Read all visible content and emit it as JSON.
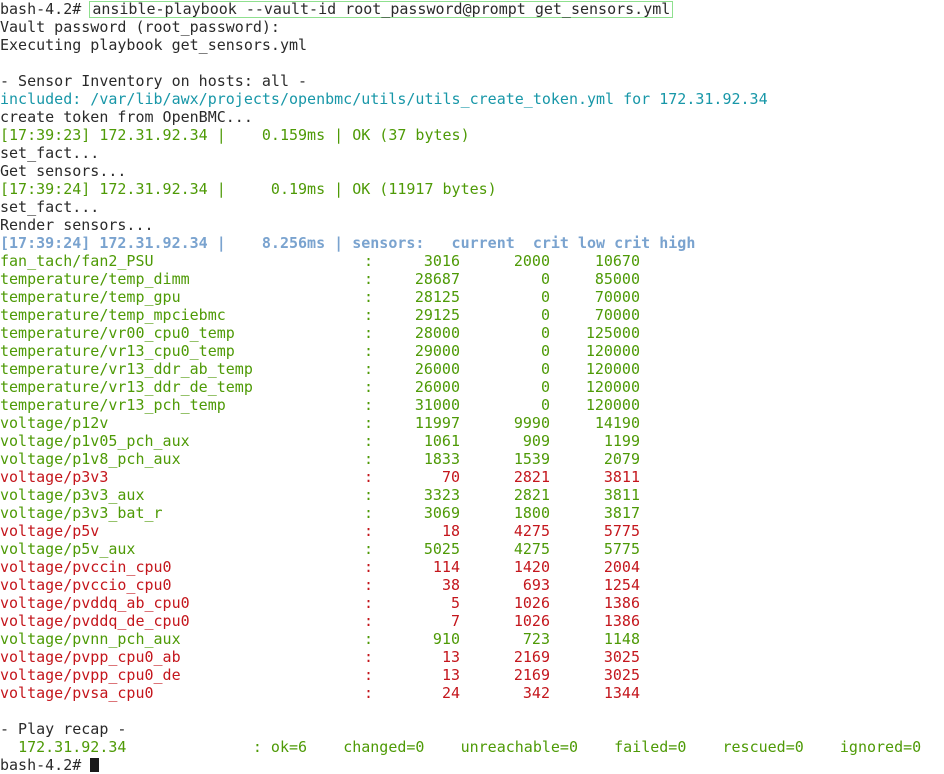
{
  "prompt": "bash-4.2#",
  "command": "ansible-playbook --vault-id root_password@prompt get_sensors.yml",
  "pre_lines": [
    {
      "text": "Vault password (root_password):",
      "style": "plain"
    },
    {
      "text": "Executing playbook get_sensors.yml",
      "style": "plain"
    },
    {
      "text": "",
      "style": "plain"
    },
    {
      "text": "- Sensor Inventory on hosts: all -",
      "style": "plain"
    },
    {
      "text": "included: /var/lib/awx/projects/openbmc/utils/utils_create_token.yml for 172.31.92.34",
      "style": "included"
    },
    {
      "text": "create token from OpenBMC...",
      "style": "plain"
    },
    {
      "text": "[17:39:23] 172.31.92.34 |    0.159ms | OK (37 bytes)",
      "style": "green"
    },
    {
      "text": "set_fact...",
      "style": "plain"
    },
    {
      "text": "Get sensors...",
      "style": "plain"
    },
    {
      "text": "[17:39:24] 172.31.92.34 |     0.19ms | OK (11917 bytes)",
      "style": "green"
    },
    {
      "text": "set_fact...",
      "style": "plain"
    },
    {
      "text": "Render sensors...",
      "style": "plain"
    }
  ],
  "table_header": "[17:39:24] 172.31.92.34 |    8.256ms | sensors:   current  crit low crit high",
  "sensors": [
    {
      "name": "fan_tach/fan2_PSU",
      "current": "3016",
      "crit_low": "2000",
      "crit_high": "10670",
      "status": "ok"
    },
    {
      "name": "temperature/temp_dimm",
      "current": "28687",
      "crit_low": "0",
      "crit_high": "85000",
      "status": "ok"
    },
    {
      "name": "temperature/temp_gpu",
      "current": "28125",
      "crit_low": "0",
      "crit_high": "70000",
      "status": "ok"
    },
    {
      "name": "temperature/temp_mpciebmc",
      "current": "29125",
      "crit_low": "0",
      "crit_high": "70000",
      "status": "ok"
    },
    {
      "name": "temperature/vr00_cpu0_temp",
      "current": "28000",
      "crit_low": "0",
      "crit_high": "125000",
      "status": "ok"
    },
    {
      "name": "temperature/vr13_cpu0_temp",
      "current": "29000",
      "crit_low": "0",
      "crit_high": "120000",
      "status": "ok"
    },
    {
      "name": "temperature/vr13_ddr_ab_temp",
      "current": "26000",
      "crit_low": "0",
      "crit_high": "120000",
      "status": "ok"
    },
    {
      "name": "temperature/vr13_ddr_de_temp",
      "current": "26000",
      "crit_low": "0",
      "crit_high": "120000",
      "status": "ok"
    },
    {
      "name": "temperature/vr13_pch_temp",
      "current": "31000",
      "crit_low": "0",
      "crit_high": "120000",
      "status": "ok"
    },
    {
      "name": "voltage/p12v",
      "current": "11997",
      "crit_low": "9990",
      "crit_high": "14190",
      "status": "ok"
    },
    {
      "name": "voltage/p1v05_pch_aux",
      "current": "1061",
      "crit_low": "909",
      "crit_high": "1199",
      "status": "ok"
    },
    {
      "name": "voltage/p1v8_pch_aux",
      "current": "1833",
      "crit_low": "1539",
      "crit_high": "2079",
      "status": "ok"
    },
    {
      "name": "voltage/p3v3",
      "current": "70",
      "crit_low": "2821",
      "crit_high": "3811",
      "status": "bad"
    },
    {
      "name": "voltage/p3v3_aux",
      "current": "3323",
      "crit_low": "2821",
      "crit_high": "3811",
      "status": "ok"
    },
    {
      "name": "voltage/p3v3_bat_r",
      "current": "3069",
      "crit_low": "1800",
      "crit_high": "3817",
      "status": "ok"
    },
    {
      "name": "voltage/p5v",
      "current": "18",
      "crit_low": "4275",
      "crit_high": "5775",
      "status": "bad"
    },
    {
      "name": "voltage/p5v_aux",
      "current": "5025",
      "crit_low": "4275",
      "crit_high": "5775",
      "status": "ok"
    },
    {
      "name": "voltage/pvccin_cpu0",
      "current": "114",
      "crit_low": "1420",
      "crit_high": "2004",
      "status": "bad"
    },
    {
      "name": "voltage/pvccio_cpu0",
      "current": "38",
      "crit_low": "693",
      "crit_high": "1254",
      "status": "bad"
    },
    {
      "name": "voltage/pvddq_ab_cpu0",
      "current": "5",
      "crit_low": "1026",
      "crit_high": "1386",
      "status": "bad"
    },
    {
      "name": "voltage/pvddq_de_cpu0",
      "current": "7",
      "crit_low": "1026",
      "crit_high": "1386",
      "status": "bad"
    },
    {
      "name": "voltage/pvnn_pch_aux",
      "current": "910",
      "crit_low": "723",
      "crit_high": "1148",
      "status": "ok"
    },
    {
      "name": "voltage/pvpp_cpu0_ab",
      "current": "13",
      "crit_low": "2169",
      "crit_high": "3025",
      "status": "bad"
    },
    {
      "name": "voltage/pvpp_cpu0_de",
      "current": "13",
      "crit_low": "2169",
      "crit_high": "3025",
      "status": "bad"
    },
    {
      "name": "voltage/pvsa_cpu0",
      "current": "24",
      "crit_low": "342",
      "crit_high": "1344",
      "status": "bad"
    }
  ],
  "colon": ":",
  "recap_title": "- Play recap -",
  "recap": {
    "host": "172.31.92.34",
    "ok": ": ok=6",
    "changed": "changed=0",
    "unreachable": "unreachable=0",
    "failed": "failed=0",
    "rescued": "rescued=0",
    "ignored": "ignored=0"
  },
  "final_prompt": "bash-4.2#",
  "colors": {
    "ok": "#4e9a06",
    "bad": "#c4161c",
    "included": "#1897a8",
    "header": "#7aa3cf"
  }
}
